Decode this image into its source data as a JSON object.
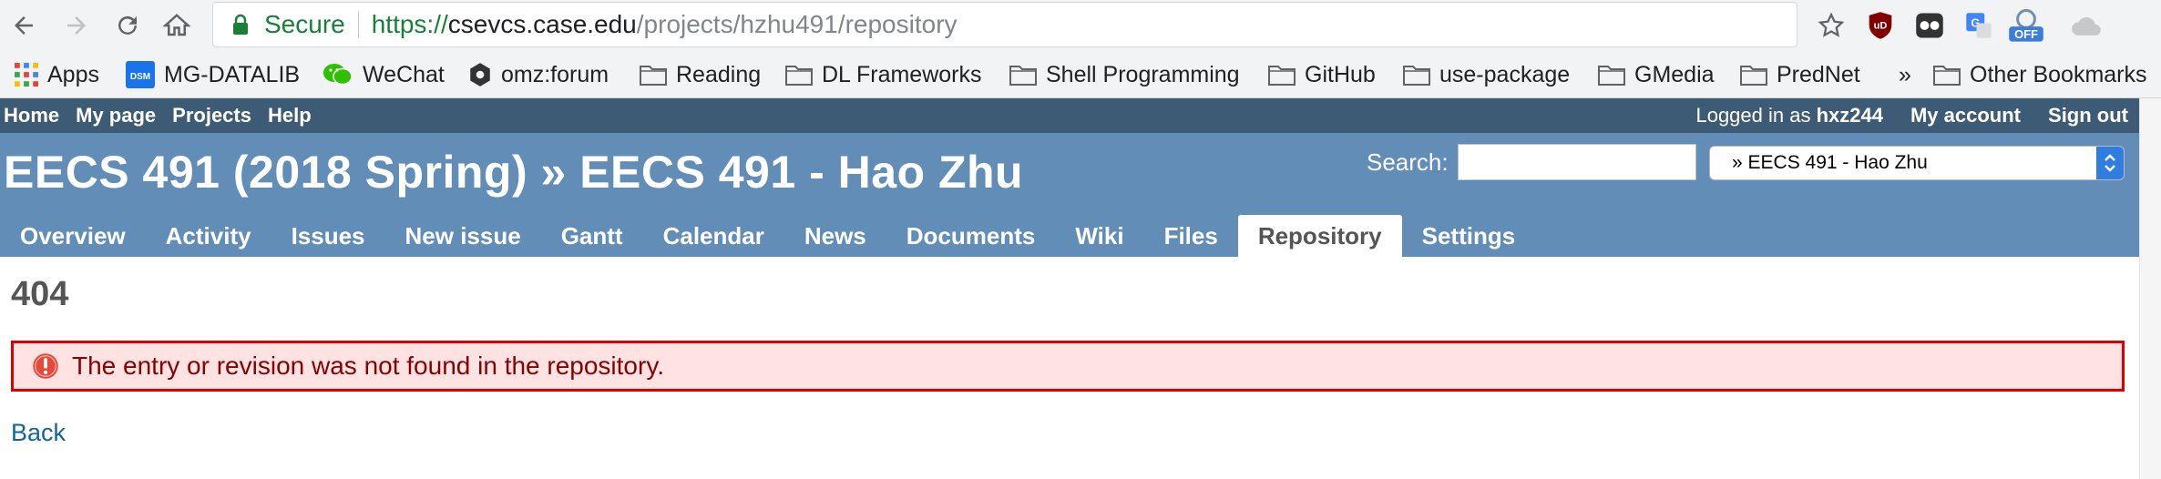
{
  "browser": {
    "url_secure_label": "Secure",
    "url_scheme": "https://",
    "url_host": "csevcs.case.edu",
    "url_path": "/projects/hzhu491/repository",
    "extensions": [
      {
        "name": "star-icon"
      },
      {
        "name": "ublock-icon",
        "label": "uD"
      },
      {
        "name": "ghostery-icon"
      },
      {
        "name": "google-translate-icon",
        "label": "G"
      },
      {
        "name": "off-toggle-icon",
        "label": "OFF"
      },
      {
        "name": "cloud-icon"
      }
    ]
  },
  "bookmarks": [
    {
      "label": "Apps",
      "icon": "apps-grid-icon"
    },
    {
      "label": "MG-DATALIB",
      "icon": "dsm-icon",
      "icon_text": "DSM"
    },
    {
      "label": "WeChat",
      "icon": "wechat-icon"
    },
    {
      "label": "omz:forum",
      "icon": "hexagon-icon"
    },
    {
      "label": "Reading",
      "icon": "folder-icon"
    },
    {
      "label": "DL Frameworks",
      "icon": "folder-icon"
    },
    {
      "label": "Shell Programming",
      "icon": "folder-icon"
    },
    {
      "label": "GitHub",
      "icon": "folder-icon"
    },
    {
      "label": "use-package",
      "icon": "folder-icon"
    },
    {
      "label": "GMedia",
      "icon": "folder-icon"
    },
    {
      "label": "PredNet",
      "icon": "folder-icon"
    },
    {
      "label": "»",
      "icon": "chevron-icon"
    },
    {
      "label": "Other Bookmarks",
      "icon": "folder-icon"
    }
  ],
  "top_menu": {
    "left": [
      "Home",
      "My page",
      "Projects",
      "Help"
    ],
    "logged_in_prefix": "Logged in as",
    "logged_in_user": "hxz244",
    "my_account": "My account",
    "sign_out": "Sign out"
  },
  "header": {
    "title": "EECS 491 (2018 Spring) » EECS 491 - Hao Zhu",
    "search_label": "Search:",
    "search_value": "",
    "project_jump": "» EECS 491 - Hao Zhu"
  },
  "tabs": [
    "Overview",
    "Activity",
    "Issues",
    "New issue",
    "Gantt",
    "Calendar",
    "News",
    "Documents",
    "Wiki",
    "Files",
    "Repository",
    "Settings"
  ],
  "selected_tab": "Repository",
  "content": {
    "heading": "404",
    "error_message": "The entry or revision was not found in the repository.",
    "back_link": "Back"
  },
  "colors": {
    "top_menu_bg": "#3e5b76",
    "header_bg": "#628db6",
    "error_bg": "#ffe3e3",
    "error_border": "#dd0000",
    "error_text": "#880000",
    "link": "#116699"
  }
}
